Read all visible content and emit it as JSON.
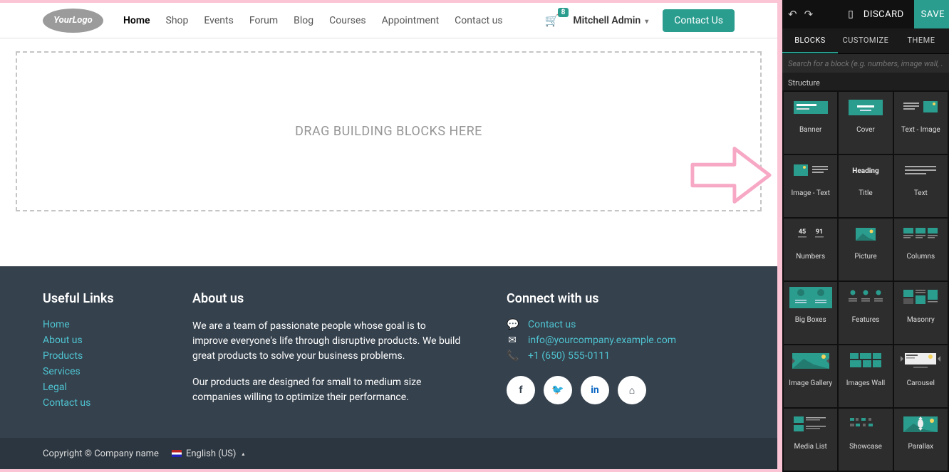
{
  "logo": {
    "text": "YourLogo"
  },
  "nav": {
    "items": [
      {
        "label": "Home",
        "active": true
      },
      {
        "label": "Shop"
      },
      {
        "label": "Events"
      },
      {
        "label": "Forum"
      },
      {
        "label": "Blog"
      },
      {
        "label": "Courses"
      },
      {
        "label": "Appointment"
      },
      {
        "label": "Contact us"
      }
    ],
    "cart_count": "8",
    "user": "Mitchell Admin",
    "contact_btn": "Contact Us"
  },
  "dropzone": {
    "text": "DRAG BUILDING BLOCKS HERE"
  },
  "footer": {
    "links_title": "Useful Links",
    "links": [
      "Home",
      "About us",
      "Products",
      "Services",
      "Legal",
      "Contact us"
    ],
    "about_title": "About us",
    "about_p1": "We are a team of passionate people whose goal is to improve everyone's life through disruptive products. We build great products to solve your business problems.",
    "about_p2": "Our products are designed for small to medium size companies willing to optimize their performance.",
    "connect_title": "Connect with us",
    "contact_link": "Contact us",
    "email": "info@yourcompany.example.com",
    "phone": "+1 (650) 555-0111",
    "copyright": "Copyright © Company name",
    "lang": "English (US)"
  },
  "panel": {
    "discard": "DISCARD",
    "save": "SAVE",
    "tabs": [
      "BLOCKS",
      "CUSTOMIZE",
      "THEME"
    ],
    "active_tab": 0,
    "search_placeholder": "Search for a block (e.g. numbers, image wall, ...)",
    "section": "Structure",
    "blocks": [
      "Banner",
      "Cover",
      "Text - Image",
      "Image - Text",
      "Title",
      "Text",
      "Numbers",
      "Picture",
      "Columns",
      "Big Boxes",
      "Features",
      "Masonry",
      "Image Gallery",
      "Images Wall",
      "Carousel",
      "Media List",
      "Showcase",
      "Parallax"
    ]
  }
}
